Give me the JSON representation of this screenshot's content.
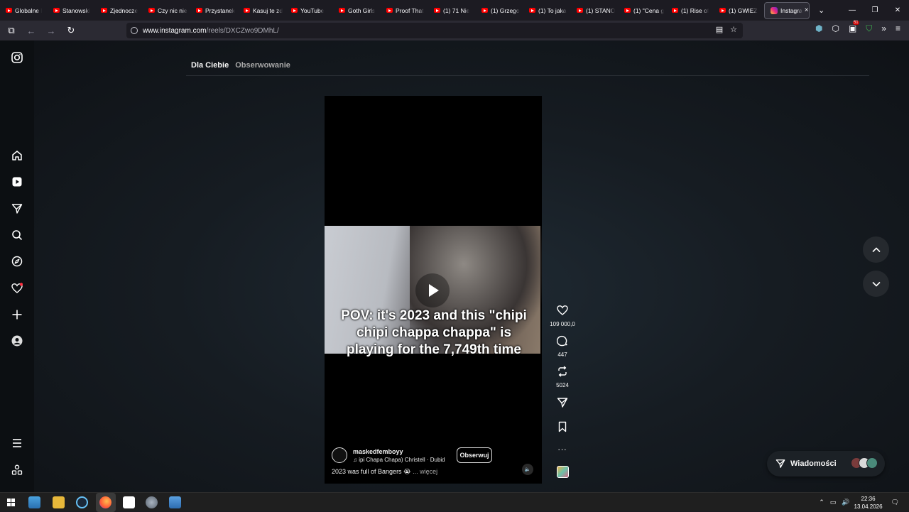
{
  "browser": {
    "tabs": [
      {
        "label": "Globalne l"
      },
      {
        "label": "Stanowski"
      },
      {
        "label": "Zjednocze"
      },
      {
        "label": "Czy nic nie"
      },
      {
        "label": "Przystanek"
      },
      {
        "label": "Kasuj te zd"
      },
      {
        "label": "YouTube"
      },
      {
        "label": "Goth Girls"
      },
      {
        "label": "Proof That"
      },
      {
        "label": "(1) 71 Nie"
      },
      {
        "label": "(1) Grzego"
      },
      {
        "label": "(1) To jaka"
      },
      {
        "label": "(1) STANO"
      },
      {
        "label": "(1) \"Cena g"
      },
      {
        "label": "(1) Rise of"
      },
      {
        "label": "(1) GWIEZ"
      }
    ],
    "active_tab": {
      "label": "Instagra",
      "close": "×"
    },
    "url": {
      "domain": "www.instagram.com",
      "path": "/reels/DXCZwo9DMhL/"
    },
    "ext_badge": "51"
  },
  "instagram": {
    "feed_tabs": {
      "for_you": "Dla Ciebie",
      "following": "Obserwowanie"
    },
    "reel": {
      "caption": "POV: it's 2023 and this \"chipi chipi chappa chappa\" is playing for the 7,749th time",
      "author": "maskedfemboyy",
      "music": "ipi Chapa Chapa)  Christell · Dubid",
      "music_icon": "♫",
      "follow_label": "Obserwuj",
      "description": "2023 was full of Bangers 😭",
      "more": "... więcej"
    },
    "actions": {
      "likes": "109 000,0",
      "comments": "447",
      "reposts": "5024",
      "more": "..."
    },
    "messages_label": "Wiadomości",
    "accent": "#ff3040"
  },
  "taskbar": {
    "time": "22:36",
    "date": "13.04.2026"
  }
}
